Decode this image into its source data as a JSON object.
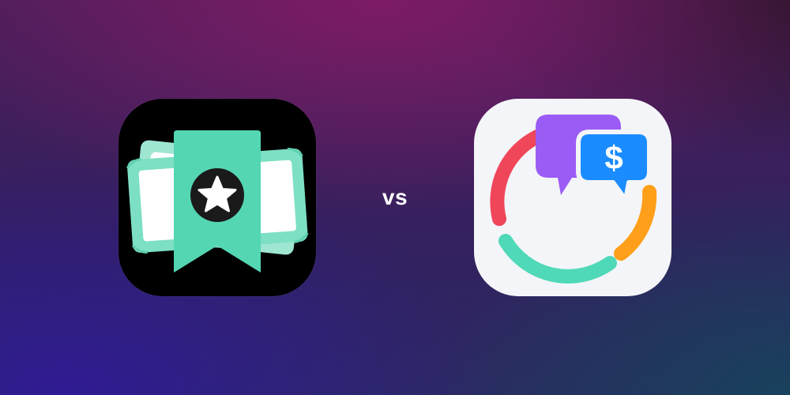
{
  "comparison": {
    "separator_label": "vs"
  },
  "left_app": {
    "icon": "money-bookmark-star-icon",
    "background_color": "#000000",
    "accent_color": "#54d6b3"
  },
  "right_app": {
    "icon": "chat-bubbles-dollar-ring-icon",
    "background_color": "#f4f5f8",
    "bubble_symbol": "$",
    "colors": {
      "ring_red": "#f0465a",
      "ring_orange": "#ff9f1a",
      "ring_teal": "#4fd9b8",
      "bubble_purple": "#9b5cf5",
      "bubble_blue": "#1a8cff"
    }
  }
}
